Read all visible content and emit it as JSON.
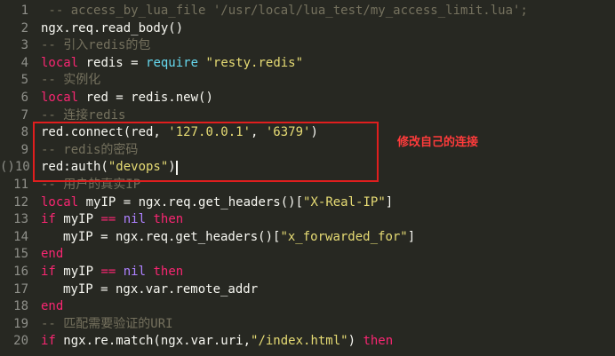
{
  "editor": {
    "lines": [
      {
        "number": "1",
        "tokens": [
          {
            "t": "comment",
            "v": " -- access_by_lua_file '/usr/local/lua_test/my_access_limit.lua';"
          }
        ]
      },
      {
        "number": "2",
        "tokens": [
          {
            "t": "plain",
            "v": "ngx.req.read_body()"
          }
        ]
      },
      {
        "number": "3",
        "tokens": [
          {
            "t": "comment",
            "v": "-- 引入redis的包"
          }
        ]
      },
      {
        "number": "4",
        "tokens": [
          {
            "t": "keyword",
            "v": "local"
          },
          {
            "t": "plain",
            "v": " redis = "
          },
          {
            "t": "builtin",
            "v": "require"
          },
          {
            "t": "plain",
            "v": " "
          },
          {
            "t": "string",
            "v": "\"resty.redis\""
          }
        ]
      },
      {
        "number": "5",
        "tokens": [
          {
            "t": "comment",
            "v": "-- 实例化"
          }
        ]
      },
      {
        "number": "6",
        "tokens": [
          {
            "t": "keyword",
            "v": "local"
          },
          {
            "t": "plain",
            "v": " red = redis.new()"
          }
        ]
      },
      {
        "number": "7",
        "tokens": [
          {
            "t": "comment",
            "v": "-- 连接redis"
          }
        ]
      },
      {
        "number": "8",
        "tokens": [
          {
            "t": "plain",
            "v": "red.connect(red, "
          },
          {
            "t": "string",
            "v": "'127.0.0.1'"
          },
          {
            "t": "plain",
            "v": ", "
          },
          {
            "t": "string",
            "v": "'6379'"
          },
          {
            "t": "plain",
            "v": ")"
          }
        ]
      },
      {
        "number": "9",
        "tokens": [
          {
            "t": "comment",
            "v": "-- redis的密码"
          }
        ]
      },
      {
        "number": "()10",
        "tokens": [
          {
            "t": "plain",
            "v": "red:auth("
          },
          {
            "t": "string",
            "v": "\"devops\""
          },
          {
            "t": "plain",
            "v": ")"
          }
        ]
      },
      {
        "number": "11",
        "tokens": [
          {
            "t": "comment",
            "v": "-- 用户的真实IP"
          }
        ]
      },
      {
        "number": "12",
        "tokens": [
          {
            "t": "keyword",
            "v": "local"
          },
          {
            "t": "plain",
            "v": " myIP = ngx.req.get_headers()["
          },
          {
            "t": "string",
            "v": "\"X-Real-IP\""
          },
          {
            "t": "plain",
            "v": "]"
          }
        ]
      },
      {
        "number": "13",
        "tokens": [
          {
            "t": "keyword",
            "v": "if"
          },
          {
            "t": "plain",
            "v": " myIP "
          },
          {
            "t": "keyword",
            "v": "=="
          },
          {
            "t": "plain",
            "v": " "
          },
          {
            "t": "nil",
            "v": "nil"
          },
          {
            "t": "plain",
            "v": " "
          },
          {
            "t": "keyword",
            "v": "then"
          }
        ]
      },
      {
        "number": "14",
        "indent": true,
        "tokens": [
          {
            "t": "plain",
            "v": "myIP = ngx.req.get_headers()["
          },
          {
            "t": "string",
            "v": "\"x_forwarded_for\""
          },
          {
            "t": "plain",
            "v": "]"
          }
        ]
      },
      {
        "number": "15",
        "tokens": [
          {
            "t": "keyword",
            "v": "end"
          }
        ]
      },
      {
        "number": "16",
        "tokens": [
          {
            "t": "keyword",
            "v": "if"
          },
          {
            "t": "plain",
            "v": " myIP "
          },
          {
            "t": "keyword",
            "v": "=="
          },
          {
            "t": "plain",
            "v": " "
          },
          {
            "t": "nil",
            "v": "nil"
          },
          {
            "t": "plain",
            "v": " "
          },
          {
            "t": "keyword",
            "v": "then"
          }
        ]
      },
      {
        "number": "17",
        "indent": true,
        "tokens": [
          {
            "t": "plain",
            "v": "myIP = ngx.var.remote_addr"
          }
        ]
      },
      {
        "number": "18",
        "tokens": [
          {
            "t": "keyword",
            "v": "end"
          }
        ]
      },
      {
        "number": "19",
        "tokens": [
          {
            "t": "comment",
            "v": "-- 匹配需要验证的URI"
          }
        ]
      },
      {
        "number": "20",
        "tokens": [
          {
            "t": "keyword",
            "v": "if"
          },
          {
            "t": "plain",
            "v": " ngx.re.match(ngx.var.uri,"
          },
          {
            "t": "string",
            "v": "\"/index.html\""
          },
          {
            "t": "plain",
            "v": ") "
          },
          {
            "t": "keyword",
            "v": "then"
          }
        ]
      }
    ],
    "cursor_line_number": "()10"
  },
  "annotation": {
    "text": "修改自己的连接"
  },
  "colors": {
    "background": "#272822",
    "comment": "#75715e",
    "keyword": "#f92672",
    "string": "#e6db74",
    "builtin": "#66d9ef",
    "plain": "#f8f8f2",
    "nil": "#ae81ff",
    "box": "#e01e1e",
    "annotation": "#ff3b3b"
  }
}
